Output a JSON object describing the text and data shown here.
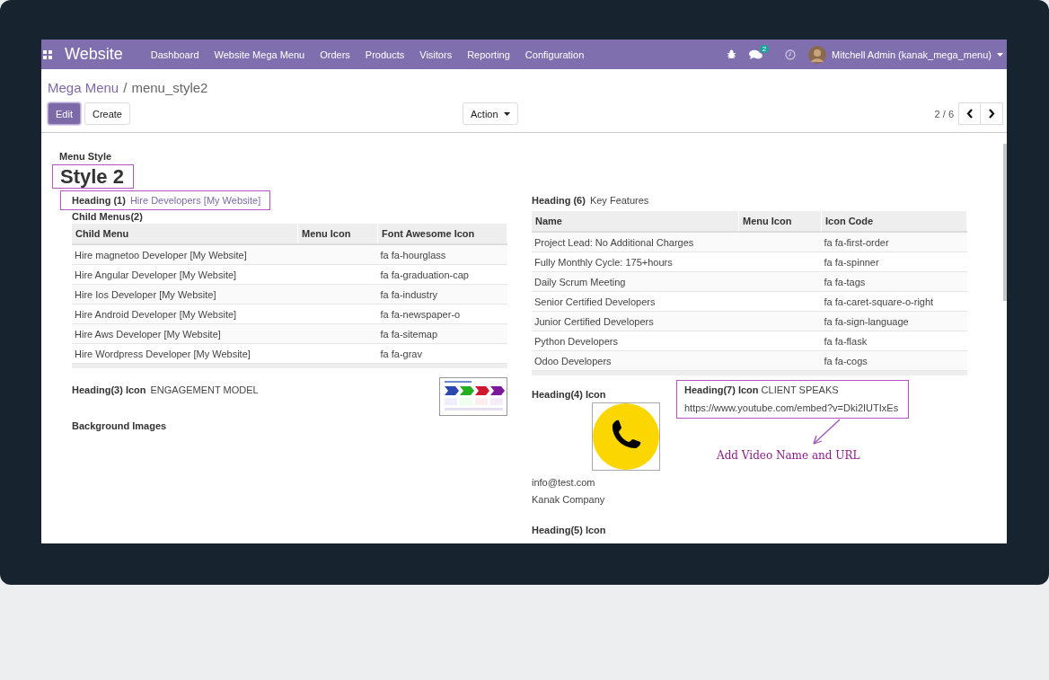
{
  "navbar": {
    "app_name": "Website",
    "menu": [
      "Dashboard",
      "Website Mega Menu",
      "Orders",
      "Products",
      "Visitors",
      "Reporting",
      "Configuration"
    ],
    "messages_count": "2",
    "user": "Mitchell Admin (kanak_mega_menu)"
  },
  "breadcrumb": {
    "parent": "Mega Menu",
    "separator": "/",
    "current": "menu_style2"
  },
  "buttons": {
    "edit": "Edit",
    "create": "Create",
    "action": "Action"
  },
  "pager": "2 / 6",
  "form": {
    "menu_style_label": "Menu Style",
    "menu_style": "Style 2",
    "heading1": {
      "label": "Heading (1)",
      "value": "Hire Developers [My Website]"
    },
    "child_menus": {
      "label": "Child Menus(2)",
      "columns": [
        "Child Menu",
        "Menu Icon",
        "Font Awesome Icon"
      ],
      "rows": [
        {
          "name": "Hire magnetoo Developer [My Website]",
          "icon_code": "fa fa-hourglass"
        },
        {
          "name": "Hire Angular Developer [My Website]",
          "icon_code": "fa fa-graduation-cap"
        },
        {
          "name": "Hire Ios Developer [My Website]",
          "icon_code": "fa fa-industry"
        },
        {
          "name": "Hire Android Developer [My Website]",
          "icon_code": "fa fa-newspaper-o"
        },
        {
          "name": "Hire Aws Developer [My Website]",
          "icon_code": "fa fa-sitemap"
        },
        {
          "name": "Hire Wordpress Developer [My Website]",
          "icon_code": "fa fa-grav"
        }
      ]
    },
    "heading3": {
      "label": "Heading(3) Icon",
      "value": "ENGAGEMENT MODEL"
    },
    "background_images_label": "Background Images",
    "heading6": {
      "label": "Heading (6)",
      "value": "Key Features",
      "columns": [
        "Name",
        "Menu Icon",
        "Icon Code"
      ],
      "rows": [
        {
          "name": "Project Lead: No Additional Charges",
          "icon_code": "fa fa-first-order"
        },
        {
          "name": "Fully Monthly Cycle: 175+hours",
          "icon_code": "fa fa-spinner"
        },
        {
          "name": "Daily Scrum Meeting",
          "icon_code": "fa fa-tags"
        },
        {
          "name": "Senior Certified Developers",
          "icon_code": "fa fa-caret-square-o-right"
        },
        {
          "name": "Junior Certified Developers",
          "icon_code": "fa fa-sign-language"
        },
        {
          "name": "Python Developers",
          "icon_code": "fa fa-flask"
        },
        {
          "name": "Odoo Developers",
          "icon_code": "fa fa-cogs"
        }
      ]
    },
    "heading4": {
      "label": "Heading(4) Icon",
      "email": "info@test.com",
      "company": "Kanak Company"
    },
    "heading7": {
      "label": "Heading(7) Icon",
      "value": "CLIENT SPEAKS",
      "url": "https://www.youtube.com/embed?v=Dki2IUTIxEs"
    },
    "heading5": {
      "label": "Heading(5) Icon"
    }
  },
  "annotation": "Add Video Name and URL"
}
